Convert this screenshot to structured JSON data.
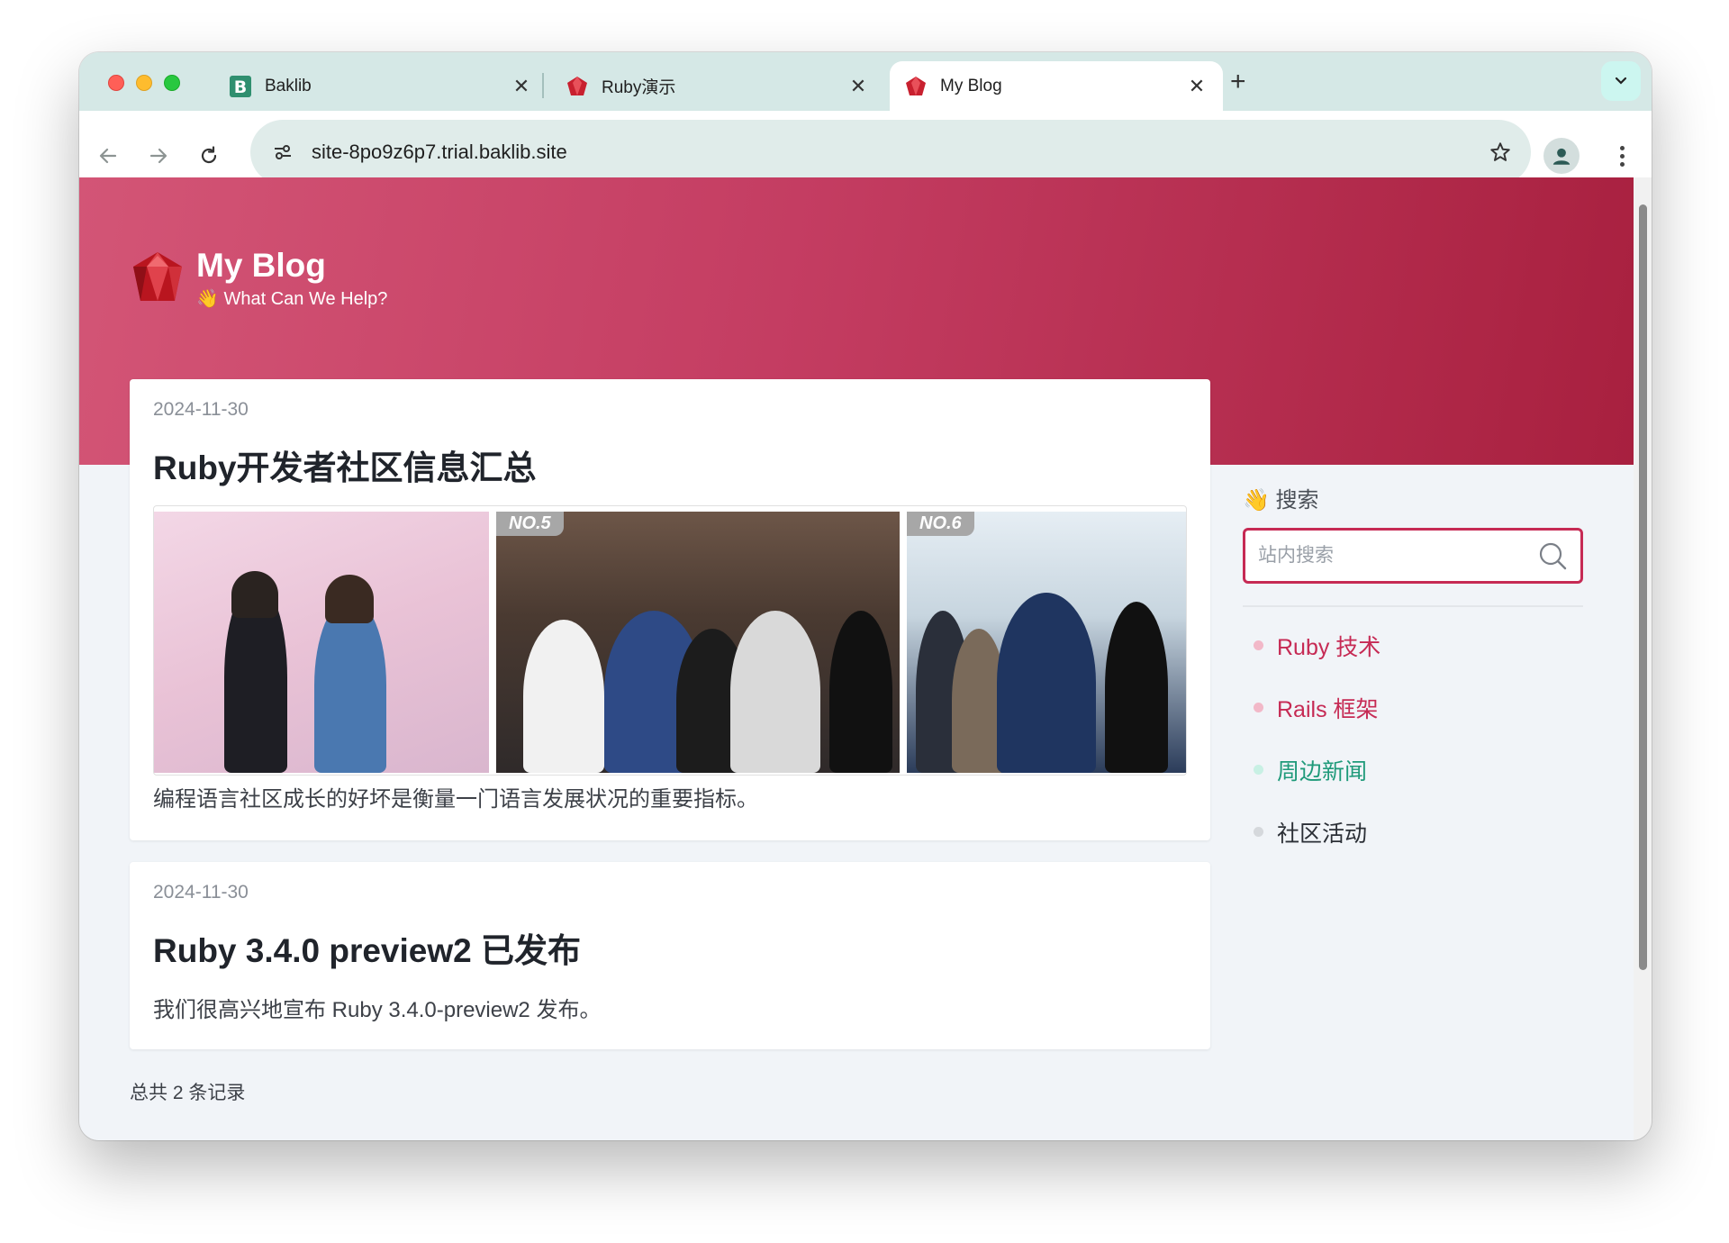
{
  "browser": {
    "tabs": [
      {
        "title": "Baklib",
        "active": false
      },
      {
        "title": "Ruby演示",
        "active": false
      },
      {
        "title": "My Blog",
        "active": true
      }
    ],
    "new_tab": "+",
    "url": "site-8po9z6p7.trial.baklib.site"
  },
  "site": {
    "name": "My Blog",
    "tagline": "👋 What Can We Help?"
  },
  "posts": [
    {
      "date": "2024-11-30",
      "title": "Ruby开发者社区信息汇总",
      "excerpt": "编程语言社区成长的好坏是衡量一门语言发展状况的重要指标。",
      "photo_badges": [
        "NO.5",
        "NO.6"
      ]
    },
    {
      "date": "2024-11-30",
      "title": "Ruby 3.4.0 preview2 已发布",
      "excerpt": "我们很高兴地宣布 Ruby 3.4.0-preview2 发布。"
    }
  ],
  "sidebar": {
    "title": "👋 搜索",
    "search_placeholder": "站内搜索",
    "categories": [
      {
        "label": "Ruby 技术",
        "color": "#c62a54",
        "dot": "#f2b8c8"
      },
      {
        "label": "Rails 框架",
        "color": "#c62a54",
        "dot": "#f2b8c8"
      },
      {
        "label": "周边新闻",
        "color": "#1f9a7a",
        "dot": "#c8f0e4"
      },
      {
        "label": "社区活动",
        "color": "#2b2f36",
        "dot": "#d5d8dc"
      }
    ]
  },
  "footer": {
    "total": "总共 2 条记录"
  },
  "colors": {
    "brand": "#c43d62",
    "accent": "#c62a54"
  }
}
